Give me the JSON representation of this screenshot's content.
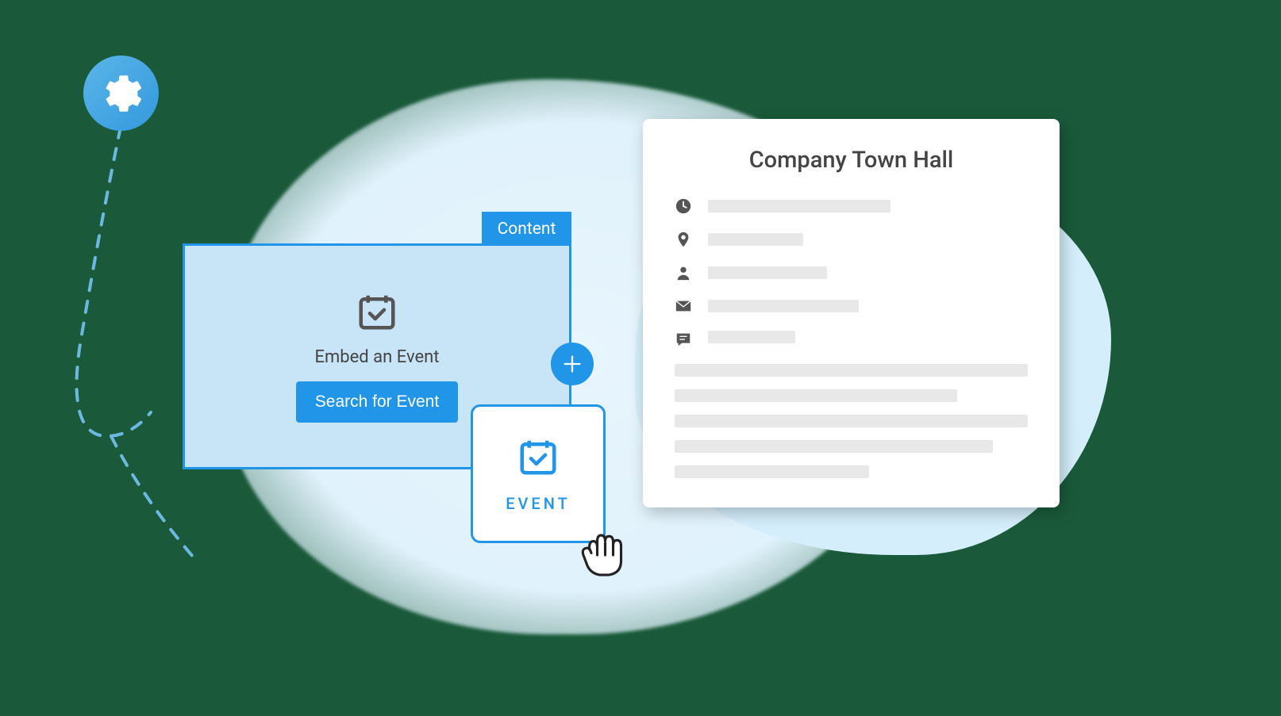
{
  "contentBlock": {
    "tabLabel": "Content",
    "embedLabel": "Embed an Event",
    "searchButton": "Search for Event"
  },
  "eventCard": {
    "label": "EVENT"
  },
  "detailsCard": {
    "title": "Company Town Hall"
  },
  "colors": {
    "primary": "#2196e8",
    "lightBlue": "#c8e4f7",
    "text": "#444"
  }
}
